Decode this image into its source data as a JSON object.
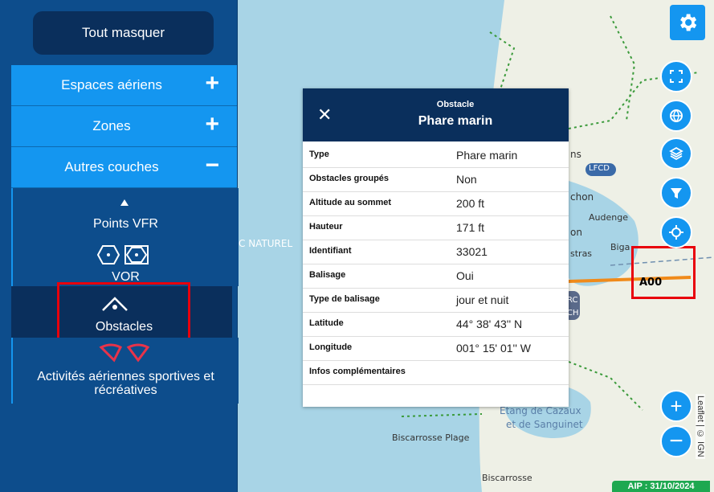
{
  "sidebar": {
    "hide_all": "Tout masquer",
    "categories": [
      {
        "label": "Espaces aériens",
        "symbol": "+"
      },
      {
        "label": "Zones",
        "symbol": "+"
      },
      {
        "label": "Autres couches",
        "symbol": "−"
      }
    ],
    "layers": {
      "points_vfr": "Points VFR",
      "vor": "VOR",
      "obstacles": "Obstacles",
      "sports": "Activités aériennes sportives et récréatives"
    }
  },
  "popup": {
    "subtitle": "Obstacle",
    "title": "Phare marin",
    "rows": [
      {
        "key": "Type",
        "value": "Phare marin"
      },
      {
        "key": "Obstacles groupés",
        "value": "Non"
      },
      {
        "key": "Altitude au sommet",
        "value": "200 ft"
      },
      {
        "key": "Hauteur",
        "value": "171 ft"
      },
      {
        "key": "Identifiant",
        "value": "33021"
      },
      {
        "key": "Balisage",
        "value": "Oui"
      },
      {
        "key": "Type de balisage",
        "value": "jour et nuit"
      },
      {
        "key": "Latitude",
        "value": "44° 38' 43'' N"
      },
      {
        "key": "Longitude",
        "value": "001° 15' 01'' W"
      },
      {
        "key": "Infos complémentaires",
        "value": ""
      }
    ]
  },
  "map": {
    "labels": {
      "naturel": "C NATUREL",
      "lfcd": "LFCD",
      "audenge": "Audenge",
      "chon": "chon",
      "ns": "ns",
      "on": "on",
      "stras": "stras",
      "biga": "Biga",
      "rc": "RC",
      "ch": "CH",
      "etang1": "Étang de Cazaux",
      "etang2": "et de Sanguinet",
      "biscarrosse_plage": "Biscarrosse Plage",
      "biscarrosse": "Biscarrosse",
      "marker": "A00"
    },
    "attribution": "Leaflet | © IGN",
    "aip": "AIP : 31/10/2024"
  },
  "colors": {
    "sidebar_bg": "#0d4d8c",
    "category_bg": "#1496f0",
    "dark_navy": "#0a2f5c",
    "highlight_red": "#e8000c",
    "sea": "#a8d4e6",
    "land": "#eef0e6",
    "aip_green": "#1ea850"
  }
}
